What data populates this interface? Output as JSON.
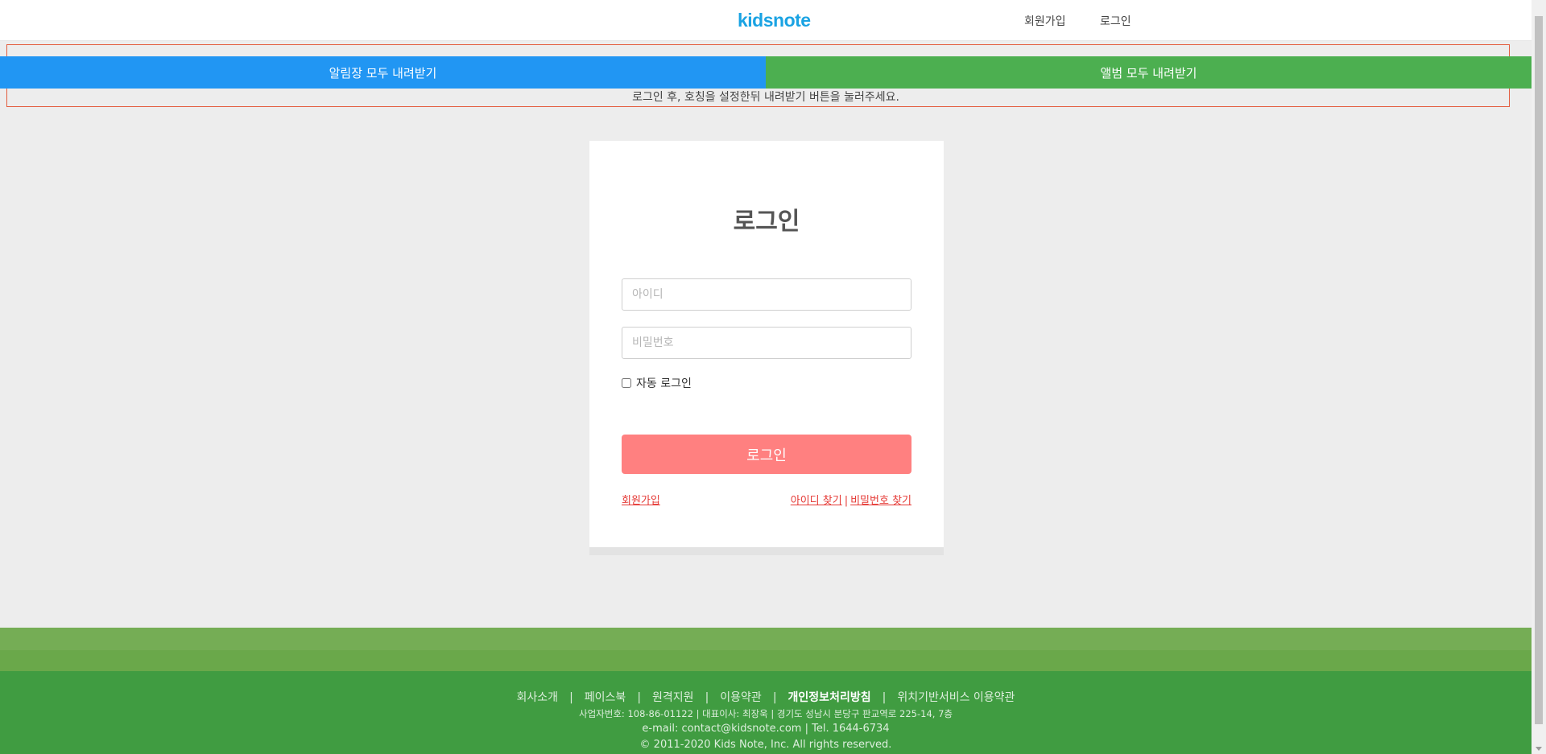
{
  "header": {
    "logo": "kidsnote",
    "nav": {
      "signup": "회원가입",
      "login": "로그인"
    }
  },
  "download": {
    "notice_button": "알림장 모두 내려받기",
    "album_button": "앨범 모두 내려받기",
    "hint": "로그인 후, 호칭을 설정한뒤 내려받기 버튼을 눌러주세요.",
    "colors": {
      "notice": "#2196f3",
      "album": "#4caf50"
    }
  },
  "login": {
    "title": "로그인",
    "id_placeholder": "아이디",
    "password_placeholder": "비밀번호",
    "auto_login_label": "자동 로그인",
    "submit_label": "로그인",
    "signup_link": "회원가입",
    "find_id_link": "아이디 찾기",
    "find_password_link": "비밀번호 찾기",
    "link_separator": "|",
    "submit_color": "#ff8080"
  },
  "footer": {
    "links": [
      "회사소개",
      "페이스북",
      "원격지원",
      "이용약관",
      "개인정보처리방침",
      "위치기반서비스 이용약관"
    ],
    "separator": "|",
    "company_info": "사업자번호: 108-86-01122  |  대표이사: 최장욱  |  경기도 성남시 분당구 판교역로 225-14, 7층",
    "contact": "e-mail: contact@kidsnote.com  |  Tel. 1644-6734",
    "copyright": "© 2011-2020 Kids Note, Inc. All rights reserved.",
    "color": "#409c41"
  }
}
